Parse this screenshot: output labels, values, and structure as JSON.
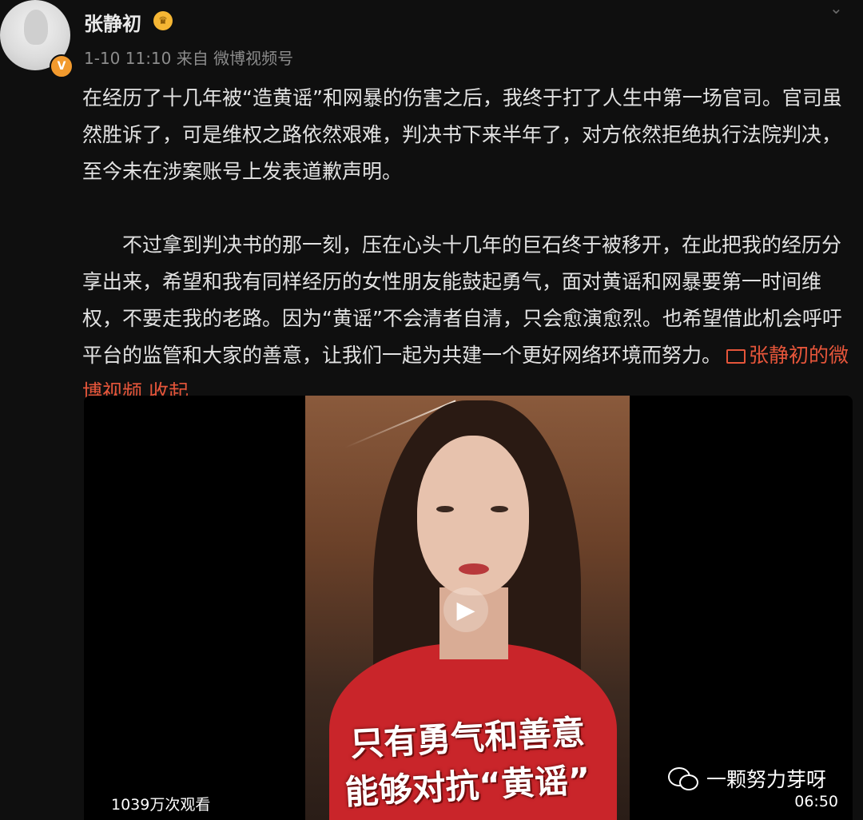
{
  "post": {
    "username": "张静初",
    "timestamp": "1-10 11:10",
    "source": "来自  微博视频号",
    "paragraph1": "在经历了十几年被“造黄谣”和网暴的伤害之后，我终于打了人生中第一场官司。官司虽然胜诉了，可是维权之路依然艰难，判决书下来半年了，对方依然拒绝执行法院判决，至今未在涉案账号上发表道歉声明。",
    "paragraph2": "不过拿到判决书的那一刻，压在心头十几年的巨石终于被移开，在此把我的经历分享出来，希望和我有同样经历的女性朋友能鼓起勇气，面对黄谣和网暴要第一时间维权，不要走我的老路。因为“黄谣”不会清者自清，只会愈演愈烈。也希望借此机会呼吁平台的监管和大家的善意，让我们一起为共建一个更好网络环境而努力。",
    "video_link": "张静初的微博视频",
    "collapse_link": "收起"
  },
  "video": {
    "caption_line1": "只有勇气和善意",
    "caption_line2": "能够对抗“黄谣”",
    "views": "1039万次观看",
    "duration": "06:50"
  },
  "watermark": {
    "text": "一颗努力芽呀"
  },
  "icons": {
    "verified": "verified-badge-icon",
    "crown": "crown-icon",
    "menu": "chevron-down-icon",
    "video": "video-icon",
    "play": "play-icon",
    "wechat": "wechat-icon"
  },
  "colors": {
    "background": "#0f0f0f",
    "link": "#e5553a",
    "verified": "#f29a2e",
    "shirt": "#c9252a"
  }
}
